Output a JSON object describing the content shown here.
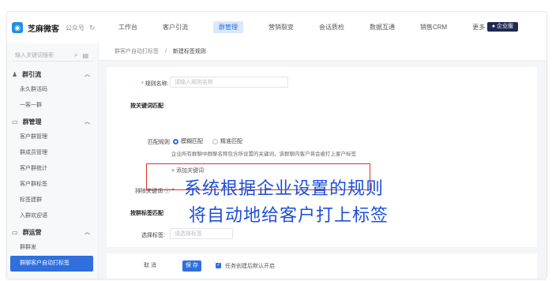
{
  "brand": {
    "logo_icon": "chat-bubble-icon",
    "name": "芝麻微客",
    "account": "公众号",
    "refresh_icon": "refresh-icon"
  },
  "nav": [
    "工作台",
    "客户引流",
    "群管理",
    "营销裂变",
    "会话质检",
    "数据互通",
    "销售CRM",
    "更多 ⌄"
  ],
  "nav_active_index": 2,
  "corp_button": "● 企业版",
  "sidebar": {
    "search_placeholder": "输入关键词搜索",
    "groups": [
      {
        "title": "群引流",
        "icon": "people-icon",
        "items": [
          "永久群活码",
          "一客一群"
        ]
      },
      {
        "title": "群管理",
        "icon": "chat-icon",
        "items": [
          "客户群管理",
          "群成员管理",
          "客户群统计",
          "客户群标签",
          "标签建群",
          "入群欢迎语"
        ]
      },
      {
        "title": "群运营",
        "icon": "chat-icon",
        "items": [
          "群群发",
          "群聊客户自动打标签"
        ]
      }
    ]
  },
  "breadcrumb": {
    "parent": "群客户自动打标签",
    "separator": "/",
    "current": "新建标签规则"
  },
  "form": {
    "rule_name_label": "规则名称:",
    "rule_name_placeholder": "请输入规则名称",
    "section_keyword": "按关键词匹配",
    "match_rule_label": "匹配规则",
    "fuzzy_match": "模糊匹配",
    "exact_match": "精准匹配",
    "match_hint": "企业所有群聊中群聊名称包含所设置的关键词，该群聊内客户将会被打上客户标签",
    "add_keyword": "+ 添加关键词",
    "exclude_keyword_label": "排除关键词 ⓘ",
    "exclude_add": "+",
    "section_tag": "按群标签匹配",
    "select_tag_label": "选择标签:",
    "select_tag_placeholder": "请选择标签"
  },
  "overlay": {
    "line1": "系统根据企业设置的规则",
    "line2": "将自动地给客户打上标签"
  },
  "footer": {
    "cancel": "取 消",
    "save": "保 存",
    "checkbox_label": "任务创建后默认开启",
    "checkbox_checked": true
  },
  "colors": {
    "primary": "#2f6fde",
    "highlight_border": "#d9342b",
    "overlay_text": "#1d4fd8"
  }
}
